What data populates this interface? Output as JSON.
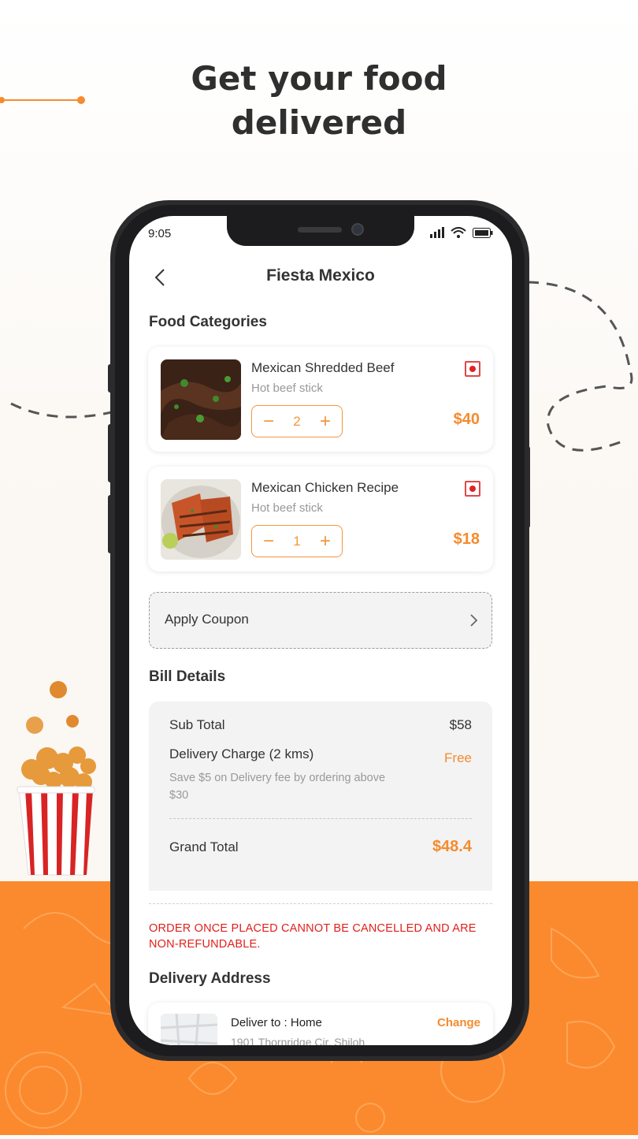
{
  "headline": {
    "line1": "Get your food",
    "line2": "delivered"
  },
  "status_bar": {
    "time": "9:05"
  },
  "nav": {
    "title": "Fiesta Mexico"
  },
  "food_categories": {
    "title": "Food Categories",
    "items": [
      {
        "name": "Mexican Shredded Beef",
        "subtitle": "Hot beef stick",
        "quantity": "2",
        "price": "$40"
      },
      {
        "name": "Mexican Chicken Recipe",
        "subtitle": "Hot beef stick",
        "quantity": "1",
        "price": "$18"
      }
    ],
    "minus_symbol": "−",
    "plus_symbol": "+"
  },
  "coupon": {
    "label": "Apply Coupon"
  },
  "bill": {
    "title": "Bill Details",
    "sub_total_label": "Sub Total",
    "sub_total_value": "$58",
    "delivery_label": "Delivery Charge (2 kms)",
    "delivery_value": "Free",
    "delivery_note": "Save $5 on Delivery fee by ordering above $30",
    "grand_total_label": "Grand Total",
    "grand_total_value": "$48.4"
  },
  "warning": "ORDER ONCE PLACED CANNOT BE CANCELLED AND ARE NON-REFUNDABLE.",
  "delivery": {
    "title": "Delivery Address",
    "deliver_to": "Deliver to : Home",
    "address": "1901 Thornridge Cir. Shiloh",
    "change_label": "Change"
  },
  "colors": {
    "accent": "#f58b2e",
    "warning": "#e0201c",
    "background_orange": "#fb8a2e"
  }
}
